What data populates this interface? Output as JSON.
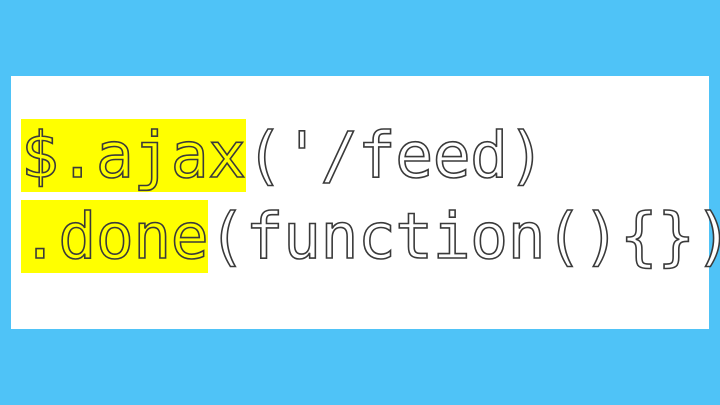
{
  "code": {
    "line1": {
      "highlighted": "$.ajax",
      "rest": "('/feed)"
    },
    "line2": {
      "highlighted": ".done",
      "rest": "(function(){})"
    }
  },
  "colors": {
    "background": "#4fc3f7",
    "panel": "#ffffff",
    "highlight": "#ffff00",
    "text_outline": "#3a3a3a"
  }
}
